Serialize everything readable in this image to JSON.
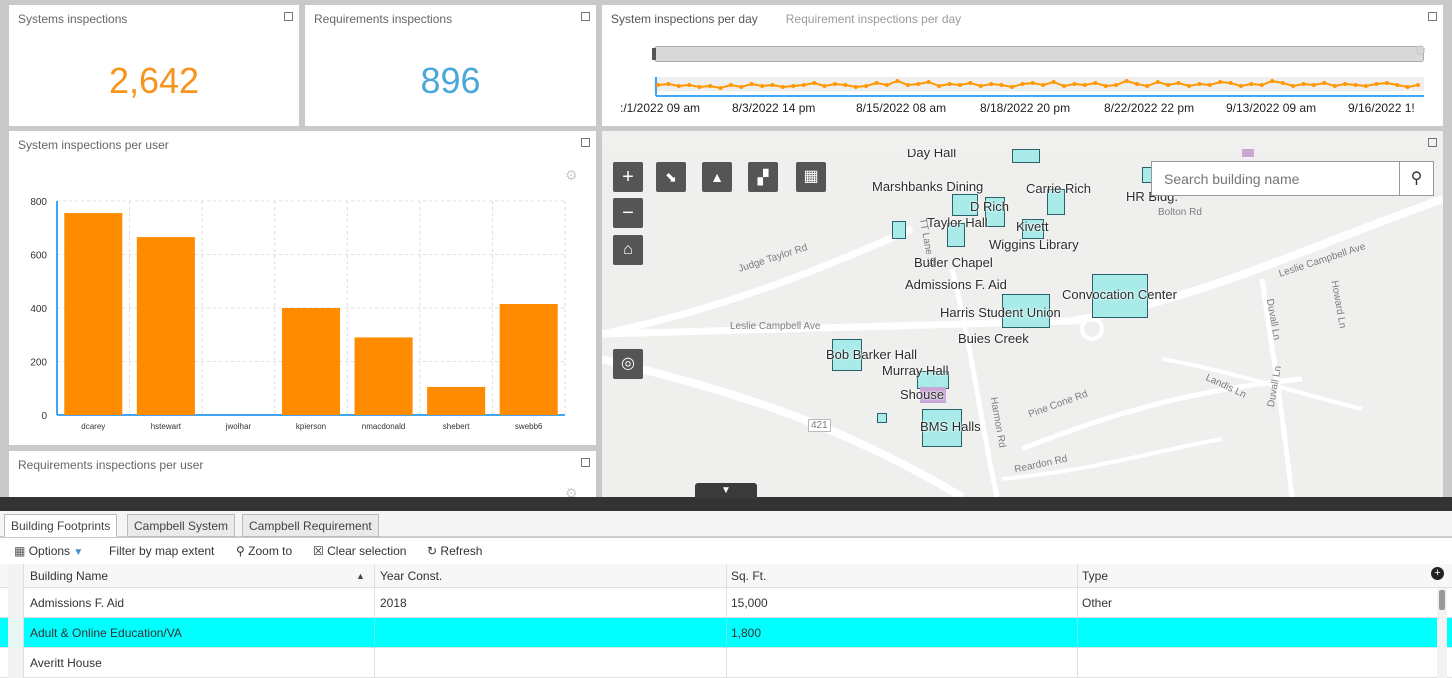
{
  "panels": {
    "systems": {
      "title": "Systems inspections",
      "value": "2,642",
      "color": "#f7941d"
    },
    "requirements": {
      "title": "Requirements inspections",
      "value": "896",
      "color": "#4aa8d8"
    },
    "per_day": {
      "tab_active": "System inspections per day",
      "tab_inactive": "Requirement inspections per day",
      "x_labels": [
        ":/1/2022 09 am",
        "8/3/2022 14 pm",
        "8/15/2022 08 am",
        "8/18/2022 20 pm",
        "8/22/2022 22 pm",
        "9/13/2022 09 am",
        "9/16/2022 1!"
      ]
    },
    "per_user": {
      "title": "System inspections per user"
    },
    "req_per_user": {
      "title": "Requirements inspections per user"
    }
  },
  "chart_data": {
    "type": "bar",
    "categories": [
      "dcarey",
      "hstewart",
      "jwolhar",
      "kpierson",
      "nmacdonald",
      "shebert",
      "swebb6"
    ],
    "values": [
      755,
      665,
      0,
      400,
      290,
      105,
      415
    ],
    "ylim": [
      0,
      800
    ],
    "yticks": [
      "0",
      "200",
      "400",
      "600",
      "800"
    ],
    "bar_color": "#ff8c00",
    "grid": true
  },
  "map": {
    "search_placeholder": "Search building name",
    "labels": [
      "Day Hall",
      "Marshbanks Dining",
      "Carrie Rich",
      "HR Bldg.",
      "D Rich",
      "Taylor Hall",
      "Kivett",
      "Wiggins Library",
      "Butler Chapel",
      "Admissions F. Aid",
      "Convocation Center",
      "Harris Student Union",
      "Buies Creek",
      "Bob Barker Hall",
      "Murray Hall",
      "Shouse",
      "BMS Halls"
    ],
    "roads": [
      "Judge Taylor Rd",
      "Leslie Campbell Ave",
      "Leslie Campbell Ave",
      "Bolton Rd",
      "TT Lane St",
      "Duvall Ln",
      "Howard Ln",
      "Landis Ln",
      "Duvall Ln",
      "Pine Cone Rd",
      "Harmon Rd",
      "Reardon Rd",
      "421"
    ],
    "buttons": [
      "+",
      "−"
    ]
  },
  "table": {
    "tabs": [
      "Building Footprints",
      "Campbell System",
      "Campbell Requirement"
    ],
    "toolbar": {
      "options": "Options",
      "filter": "Filter by map extent",
      "zoom": "Zoom to",
      "clear": "Clear selection",
      "refresh": "Refresh"
    },
    "columns": [
      "Building Name",
      "Year Const.",
      "Sq. Ft.",
      "Type"
    ],
    "rows": [
      [
        "Admissions F. Aid",
        "2018",
        "15,000",
        "Other"
      ],
      [
        "Adult & Online Education/VA",
        "",
        "1,800",
        ""
      ],
      [
        "Averitt House",
        "",
        "",
        ""
      ]
    ],
    "highlight_color": "#00ffff"
  }
}
